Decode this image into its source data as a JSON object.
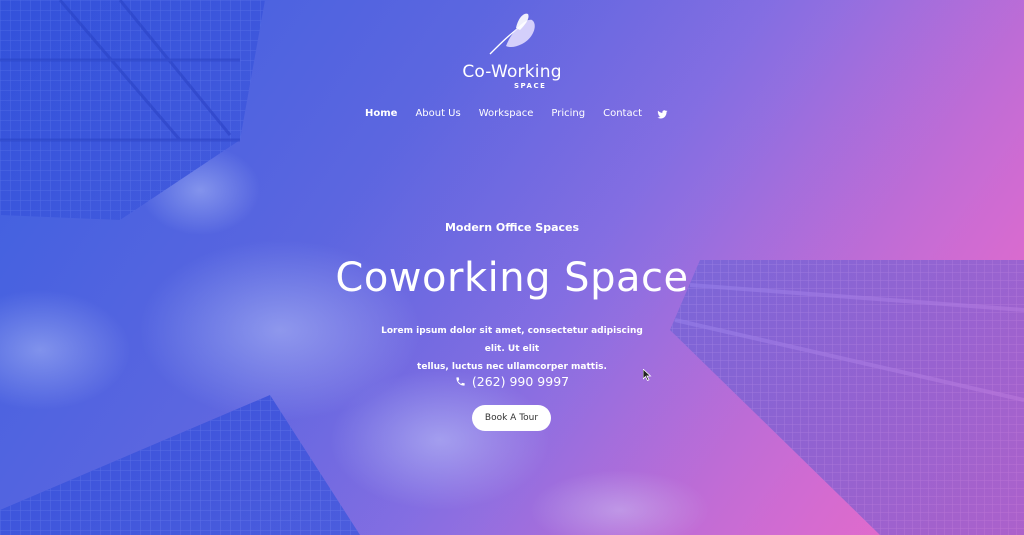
{
  "brand": {
    "name": "Co-Working",
    "sub": "SPACE"
  },
  "nav": {
    "items": [
      {
        "label": "Home"
      },
      {
        "label": "About Us"
      },
      {
        "label": "Workspace"
      },
      {
        "label": "Pricing"
      },
      {
        "label": "Contact"
      }
    ],
    "social_icon": "twitter-icon"
  },
  "hero": {
    "eyebrow": "Modern Office Spaces",
    "title": "Coworking Space",
    "description_line1": "Lorem ipsum dolor sit amet, consectetur adipiscing elit. Ut elit",
    "description_line2": "tellus, luctus nec ullamcorper mattis.",
    "phone_icon": "phone-icon",
    "phone": "(262) 990 9997",
    "cta_label": "Book A Tour"
  },
  "colors": {
    "gradient_start": "#3b5fe0",
    "gradient_end": "#f06ac6",
    "cta_bg": "#ffffff"
  }
}
